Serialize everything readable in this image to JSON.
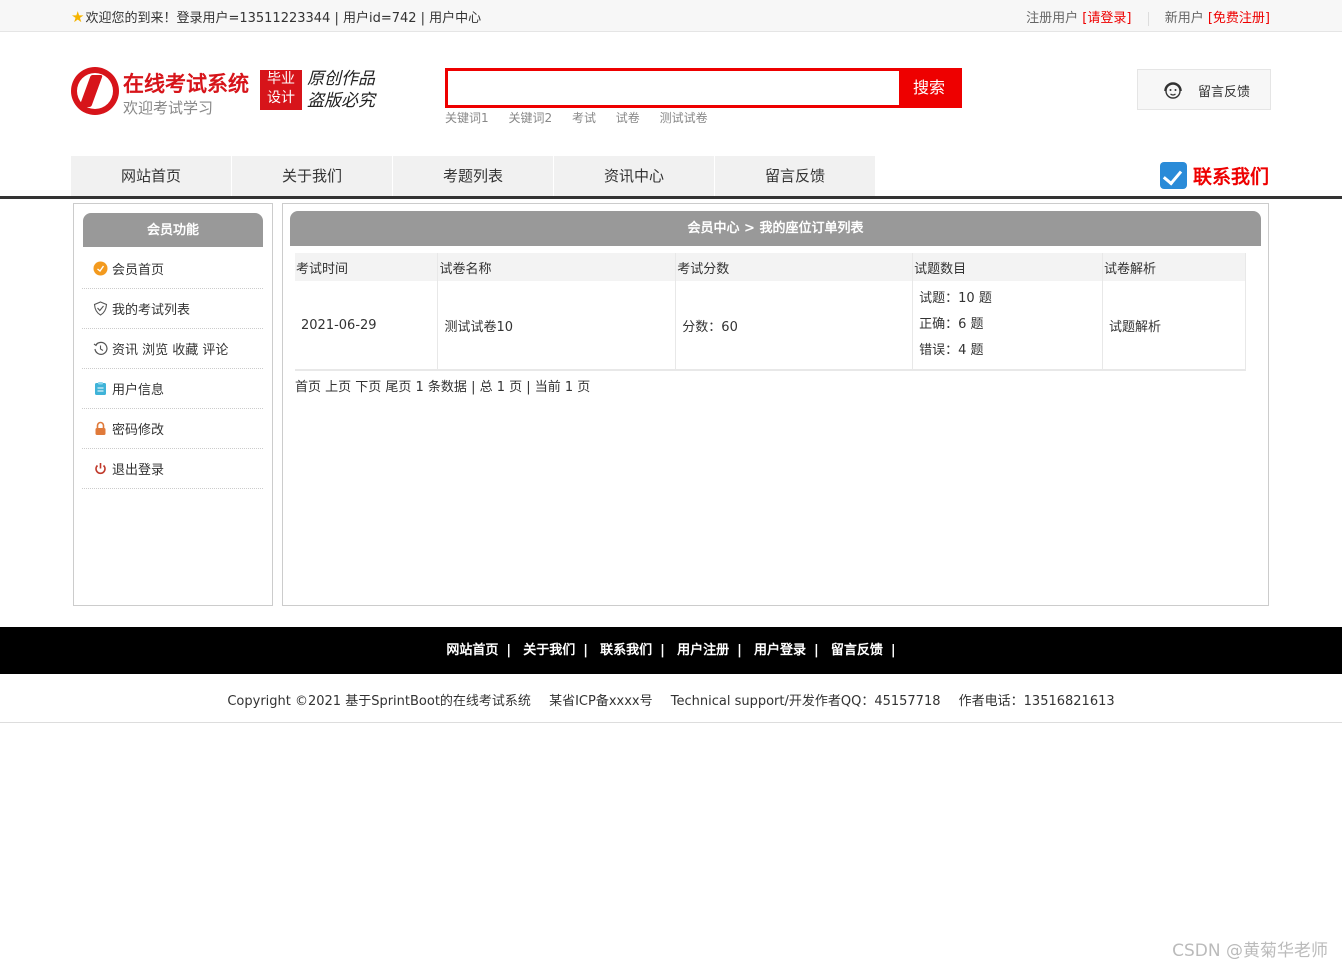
{
  "topbar": {
    "welcome": "欢迎您的到来！登录用户=13511223344 | 用户id=742 | 用户中心",
    "register_label": "注册用户",
    "login_link": "[请登录]",
    "newuser_label": "新用户",
    "signup_link": "[免费注册]"
  },
  "header": {
    "logo_title": "在线考试系统",
    "logo_subtitle": "欢迎考试学习",
    "badge_line1": "毕业",
    "badge_line2": "设计",
    "slogan_line1": "原创作品",
    "slogan_line2": "盗版必究",
    "search_placeholder": "",
    "search_button": "搜索",
    "hotwords": [
      "关键词1",
      "关键词2",
      "考试",
      "试卷",
      "测试试卷"
    ],
    "feedback_label": "留言反馈"
  },
  "nav": {
    "items": [
      "网站首页",
      "关于我们",
      "考题列表",
      "资讯中心",
      "留言反馈"
    ],
    "contact_label": "联系我们"
  },
  "sidebar": {
    "title": "会员功能",
    "items": [
      "会员首页",
      "我的考试列表",
      "资讯 浏览 收藏 评论",
      "用户信息",
      "密码修改",
      "退出登录"
    ]
  },
  "main": {
    "title": "会员中心 > 我的座位订单列表",
    "columns": [
      "考试时间",
      "试卷名称",
      "考试分数",
      "试题数目",
      "试卷解析"
    ],
    "rows": [
      {
        "time": "2021-06-29",
        "paper": "测试试卷10",
        "score": "分数：60",
        "total": "试题：10 题",
        "correct": "正确：6 题",
        "wrong": "错误：4 题",
        "analysis": "试题解析"
      }
    ],
    "pager": "首页 上页 下页 尾页 1 条数据 | 总 1 页 | 当前 1 页"
  },
  "footer": {
    "links": [
      "网站首页",
      "关于我们",
      "联系我们",
      "用户注册",
      "用户登录",
      "留言反馈"
    ],
    "copyright": "Copyright ©2021 基于SprintBoot的在线考试系统",
    "icp": "某省ICP备xxxx号",
    "support": "Technical support/开发作者QQ：45157718",
    "phone": "作者电话：13516821613"
  },
  "watermark": "CSDN @黄菊华老师",
  "colors": {
    "accent_red": "#e00000",
    "brand_red": "#d7141a",
    "panel_gray": "#999999",
    "footer_black": "#000000"
  }
}
